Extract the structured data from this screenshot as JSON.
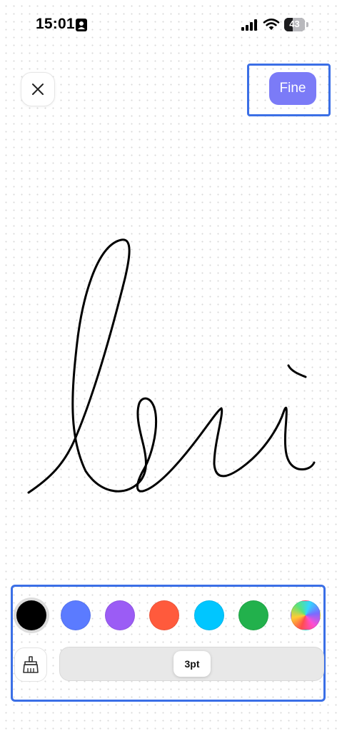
{
  "status_bar": {
    "time": "15:01",
    "battery_percent": "43",
    "icons": [
      "contact-card-icon",
      "cellular-signal-icon",
      "wifi-icon",
      "battery-icon"
    ]
  },
  "header": {
    "close_icon": "close-icon",
    "done_label": "Fine",
    "done_color": "#7b7bf7",
    "highlight_color": "#3b6fe6"
  },
  "palette": {
    "colors": [
      {
        "name": "black",
        "hex": "#000000",
        "selected": true
      },
      {
        "name": "blue",
        "hex": "#5b7bff",
        "selected": false
      },
      {
        "name": "purple",
        "hex": "#9b5cf5",
        "selected": false
      },
      {
        "name": "orange",
        "hex": "#ff5a3c",
        "selected": false
      },
      {
        "name": "cyan",
        "hex": "#00c6ff",
        "selected": false
      },
      {
        "name": "green",
        "hex": "#22b14c",
        "selected": false
      },
      {
        "name": "custom-color",
        "hex": "multicolor-gradient",
        "selected": false
      }
    ]
  },
  "tools": {
    "eraser_icon": "eraser-brush-icon",
    "stroke_width_label": "3pt",
    "stroke_width_fraction": 0.5
  },
  "canvas": {
    "stroke_color": "#000000"
  }
}
